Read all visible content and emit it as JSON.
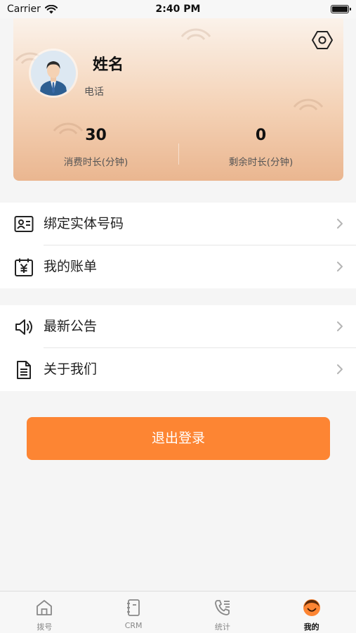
{
  "status_bar": {
    "carrier": "Carrier",
    "time": "2:40 PM"
  },
  "profile": {
    "name": "姓名",
    "phone_label": "电话",
    "stats": [
      {
        "value": "30",
        "label": "消费时长(分钟)"
      },
      {
        "value": "0",
        "label": "剩余时长(分钟)"
      }
    ]
  },
  "menu_groups": [
    [
      {
        "label": "绑定实体号码",
        "icon": "id-card-icon"
      },
      {
        "label": "我的账单",
        "icon": "bill-calendar-icon"
      }
    ],
    [
      {
        "label": "最新公告",
        "icon": "speaker-icon"
      },
      {
        "label": "关于我们",
        "icon": "document-icon"
      }
    ]
  ],
  "logout_label": "退出登录",
  "tabs": [
    {
      "label": "拨号",
      "icon": "home-icon",
      "active": false
    },
    {
      "label": "CRM",
      "icon": "notebook-icon",
      "active": false
    },
    {
      "label": "统计",
      "icon": "phone-list-icon",
      "active": false
    },
    {
      "label": "我的",
      "icon": "smiley-avatar-icon",
      "active": true
    }
  ],
  "colors": {
    "accent": "#fd8533",
    "background": "#f5f5f5"
  }
}
